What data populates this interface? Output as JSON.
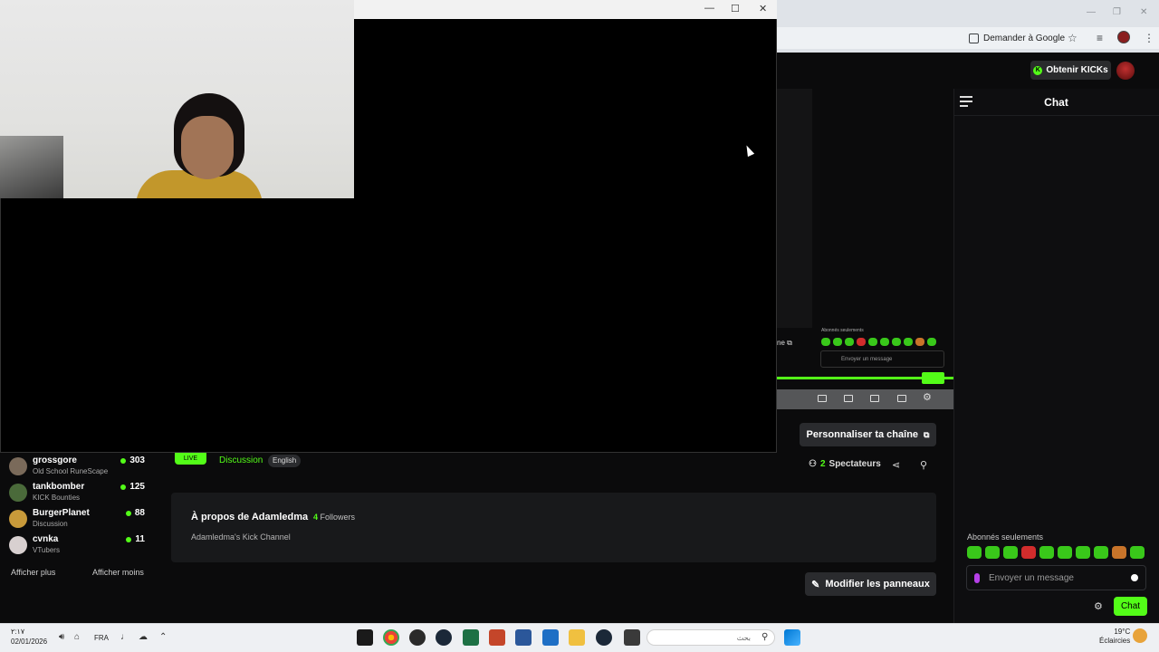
{
  "browser": {
    "google_prompt": "Demander à Google"
  },
  "kick": {
    "obtenir_label": "Obtenir KICKs",
    "chat_title": "Chat",
    "subs_only": "Abonnés seulements",
    "chat_placeholder": "Envoyer un message",
    "chat_send": "Chat",
    "mini_subs_only": "Abonnés seulements",
    "mini_chat_placeholder": "Envoyer un message",
    "chaine_tag": "ne ⧉",
    "live_badge": "LIVE",
    "category": "Discussion",
    "language": "English",
    "personaliser": "Personnaliser ta chaîne",
    "viewers_count": "2",
    "viewers_label": "Spectateurs",
    "about_title": "À propos de Adamledma",
    "followers_count": "4",
    "followers_label": "Followers",
    "about_desc": "Adamledma's Kick Channel",
    "modifier": "Modifier les panneaux"
  },
  "sidebar": {
    "channels": [
      {
        "name": "grossgore",
        "category": "Old School RuneScape",
        "count": "303",
        "color": "#7a6a5a"
      },
      {
        "name": "tankbomber",
        "category": "KICK Bounties",
        "count": "125",
        "color": "#4a6a3a"
      },
      {
        "name": "BurgerPlanet",
        "category": "Discussion",
        "count": "88",
        "color": "#c89a3a"
      },
      {
        "name": "cvnka",
        "category": "VTubers",
        "count": "11",
        "color": "#d8d0d0"
      }
    ],
    "show_more": "Afficher plus",
    "show_less": "Afficher moins"
  },
  "taskbar": {
    "time": "٢:١٧",
    "date": "02/01/2026",
    "lang": "FRA",
    "search_placeholder": "بحث",
    "temp": "19°C",
    "weather": "Éclaircies"
  },
  "colors": {
    "kick_green": "#53fc18",
    "bg_dark": "#0b0b0c"
  }
}
